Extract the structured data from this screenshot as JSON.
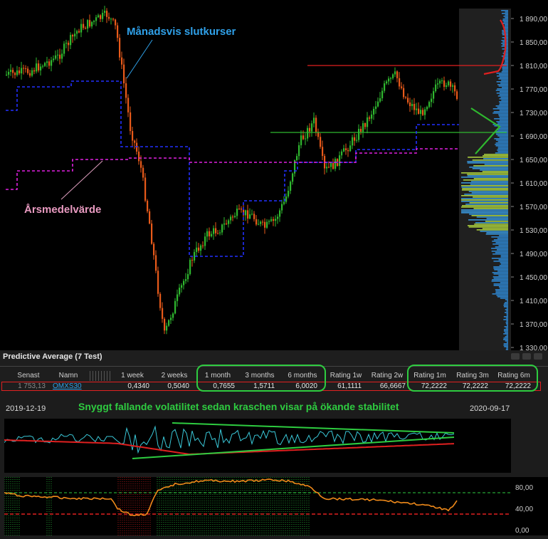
{
  "main": {
    "annotation_monthly": "Månadsvis slutkurser",
    "annotation_yearly": "Årsmedelvärde",
    "y_ticks": [
      "1 890,00",
      "1 850,00",
      "1 810,00",
      "1 770,00",
      "1 730,00",
      "1 690,00",
      "1 650,00",
      "1 610,00",
      "1 570,00",
      "1 530,00",
      "1 490,00",
      "1 450,00",
      "1 410,00",
      "1 370,00",
      "1 330,00"
    ],
    "colors": {
      "up": "#2fb82f",
      "down": "#e85a1a",
      "monthly": "#1e2cff",
      "yearly": "#e020e0",
      "profile": "#2f8fe0"
    }
  },
  "chart_data": {
    "type": "candlestick",
    "ylim": [
      1310,
      1910
    ],
    "monthly_close_levels": [
      1730,
      1770,
      1780,
      1665,
      1480,
      1575,
      1625,
      1640,
      1665,
      1705
    ],
    "yearly_average_levels": [
      1595,
      1625,
      1650,
      1640,
      1665
    ],
    "horizontal_lines": [
      {
        "value": 1808,
        "color": "#e02020"
      },
      {
        "value": 1695,
        "color": "#2fb82f"
      }
    ]
  },
  "pa": {
    "title": "Predictive Average (7  Test)",
    "headers": [
      "Senast",
      "Namn",
      "",
      "1 week",
      "2 weeks",
      "1 month",
      "3 months",
      "6 months",
      "Rating 1w",
      "Rating 2w",
      "Rating 1m",
      "Rating 3m",
      "Rating 6m"
    ],
    "row": {
      "senast": "1 753,13",
      "namn": "OMXS30",
      "w1": "0,4340",
      "w2": "0,5040",
      "m1": "0,7655",
      "m3": "1,5711",
      "m6": "6,0020",
      "r1w": "61,1111",
      "r2w": "66,6667",
      "r1m": "72,2222",
      "r3m": "72,2222",
      "r6m": "72,2222"
    }
  },
  "vol": {
    "date_left": "2019-12-19",
    "date_right": "2020-09-17",
    "title": "Snyggt fallande volatilitet sedan kraschen visar på ökande stabilitet"
  },
  "rsi": {
    "ticks": [
      "80,00",
      "40,00",
      "0,00"
    ],
    "upper_level": 72,
    "lower_level": 28
  }
}
